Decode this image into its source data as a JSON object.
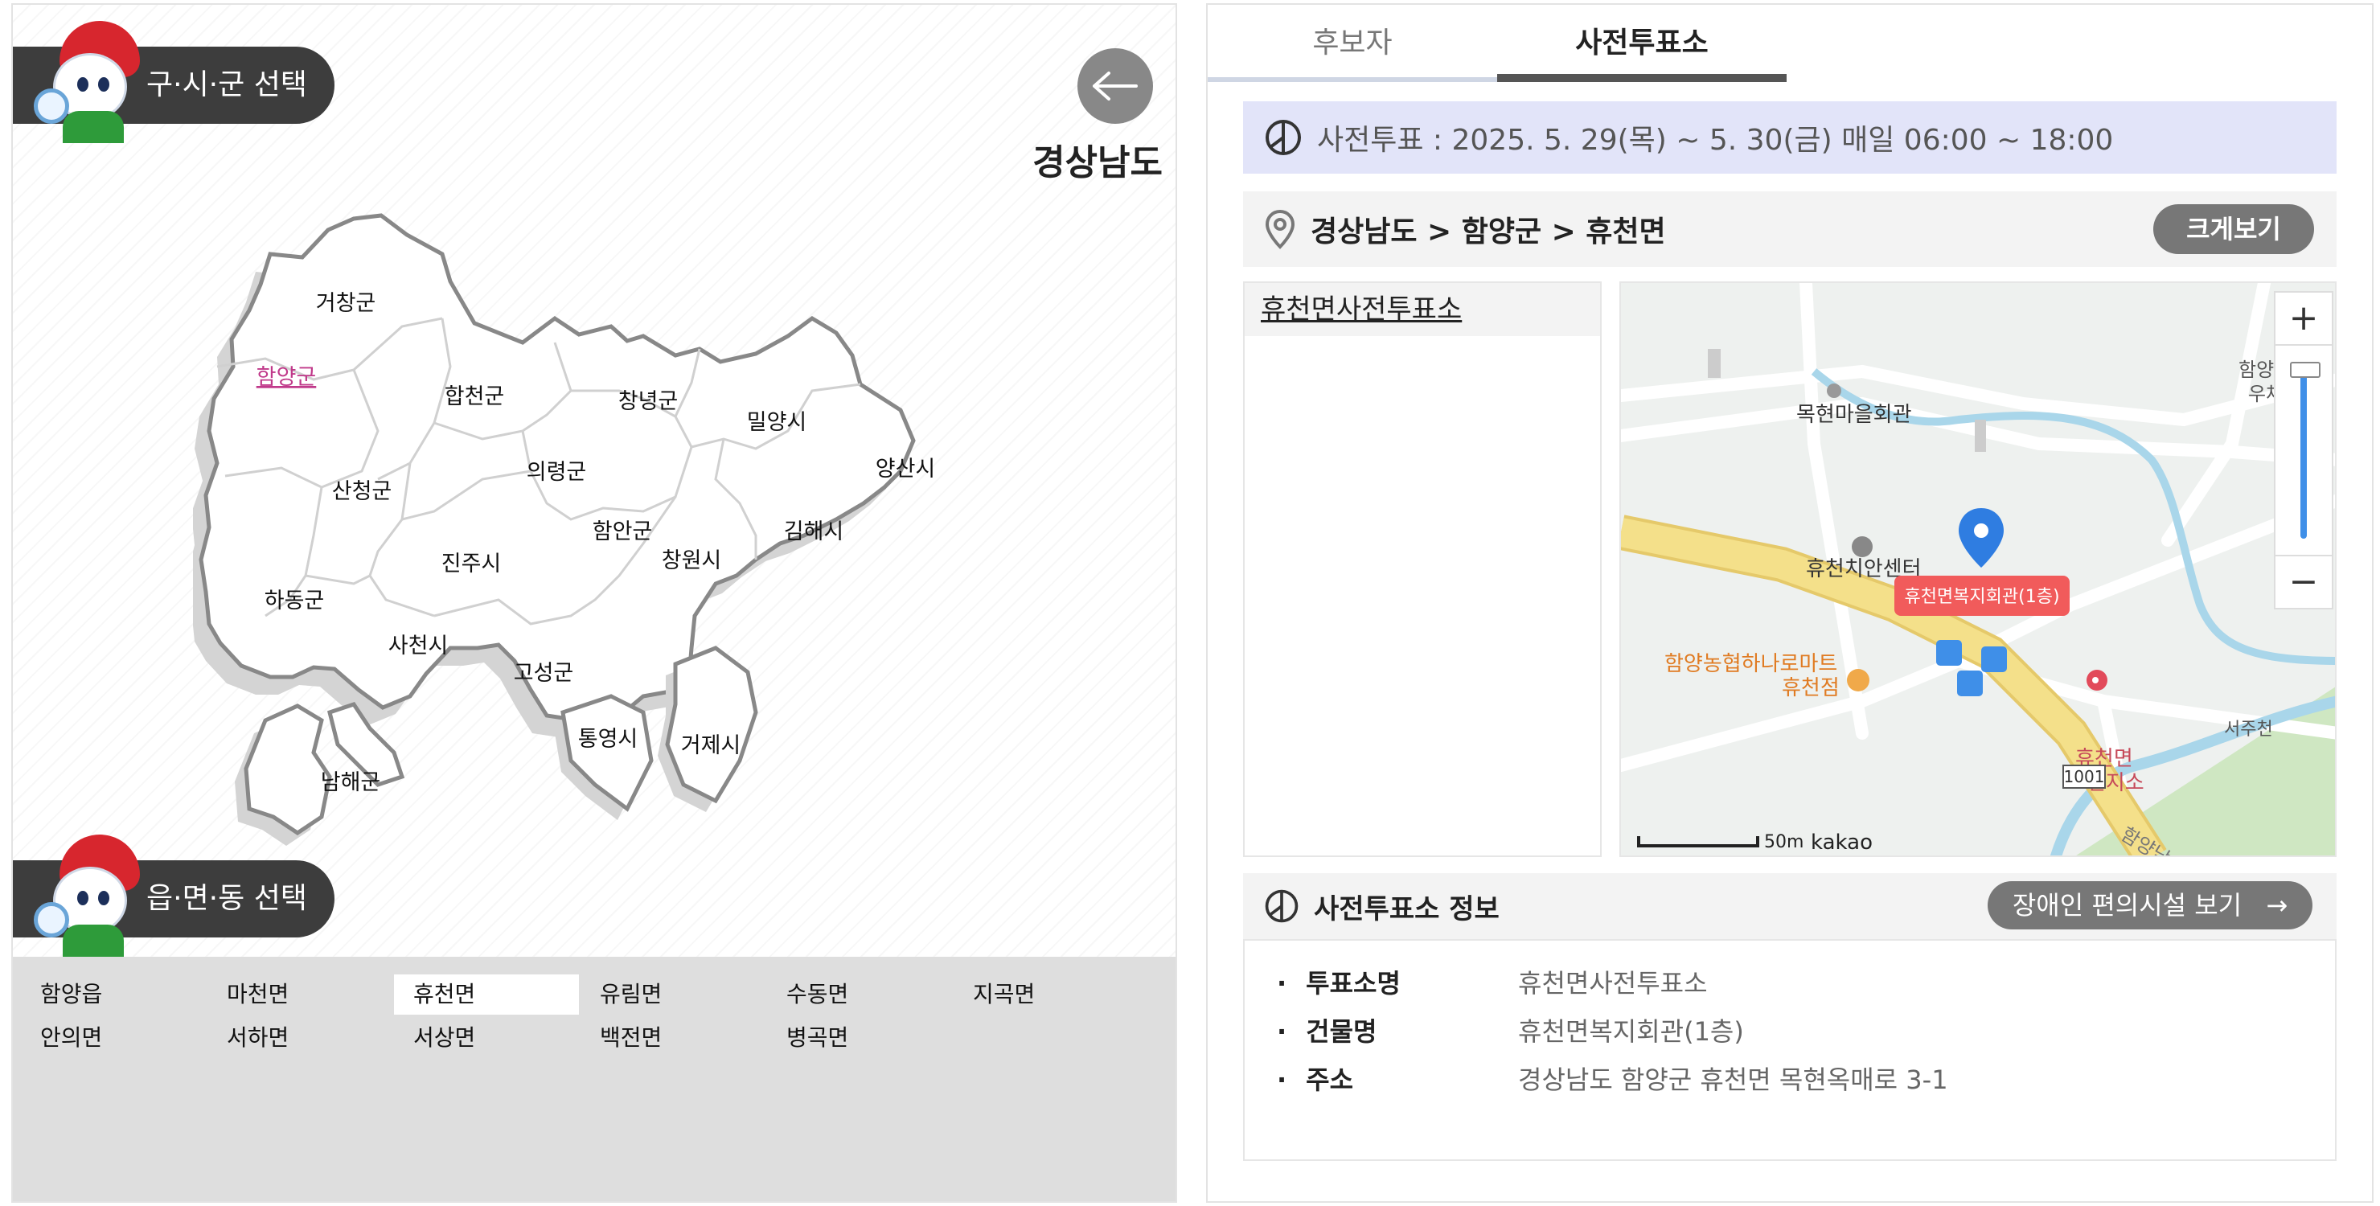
{
  "left_panel": {
    "sigungu_label": "구·시·군 선택",
    "region_title": "경상남도",
    "emd_label": "읍·면·동 선택",
    "districts": [
      {
        "name": "거창군"
      },
      {
        "name": "함양군",
        "selected": true
      },
      {
        "name": "합천군"
      },
      {
        "name": "창녕군"
      },
      {
        "name": "밀양시"
      },
      {
        "name": "양산시"
      },
      {
        "name": "산청군"
      },
      {
        "name": "의령군"
      },
      {
        "name": "함안군"
      },
      {
        "name": "김해시"
      },
      {
        "name": "진주시"
      },
      {
        "name": "창원시"
      },
      {
        "name": "하동군"
      },
      {
        "name": "사천시"
      },
      {
        "name": "고성군"
      },
      {
        "name": "통영시"
      },
      {
        "name": "거제시"
      },
      {
        "name": "남해군"
      }
    ],
    "dongs": [
      "함양읍",
      "마천면",
      "휴천면",
      "유림면",
      "수동면",
      "지곡면",
      "안의면",
      "서하면",
      "서상면",
      "백전면",
      "병곡면"
    ],
    "selected_dong": "휴천면"
  },
  "right_panel": {
    "tabs": [
      {
        "label": "후보자",
        "active": false
      },
      {
        "label": "사전투표소",
        "active": true
      }
    ],
    "notice": "사전투표 : 2025. 5. 29(목) ~ 5. 30(금) 매일 06:00 ~ 18:00",
    "breadcrumb": "경상남도 > 함양군 > 휴천면",
    "enlarge_label": "크게보기",
    "stations": [
      "휴천면사전투표소"
    ],
    "map": {
      "labels": [
        "목현마을회관",
        "휴천치안센터",
        "휴천면복지회관(1층)",
        "함양농협하나로마트",
        "휴천점",
        "휴천면",
        "보건지소",
        "서주천",
        "함양남서로",
        "1001",
        "함양",
        "우체",
        "50m",
        "kakao"
      ]
    },
    "info": {
      "title": "사전투표소 정보",
      "accessibility_label": "장애인 편의시설 보기",
      "rows": [
        {
          "key": "투표소명",
          "value": "휴천면사전투표소"
        },
        {
          "key": "건물명",
          "value": "휴천면복지회관(1층)"
        },
        {
          "key": "주소",
          "value": "경상남도 함양군 휴천면 목현옥매로 3-1"
        }
      ]
    }
  },
  "colors": {
    "accent": "#3d3d3d",
    "selected_district": "#c0398a",
    "tab_active": "#555555",
    "notice_bg": "#e2e4f9",
    "pin": "#2f7de1",
    "route": "#f4e08a",
    "river": "#a9d6ea"
  }
}
